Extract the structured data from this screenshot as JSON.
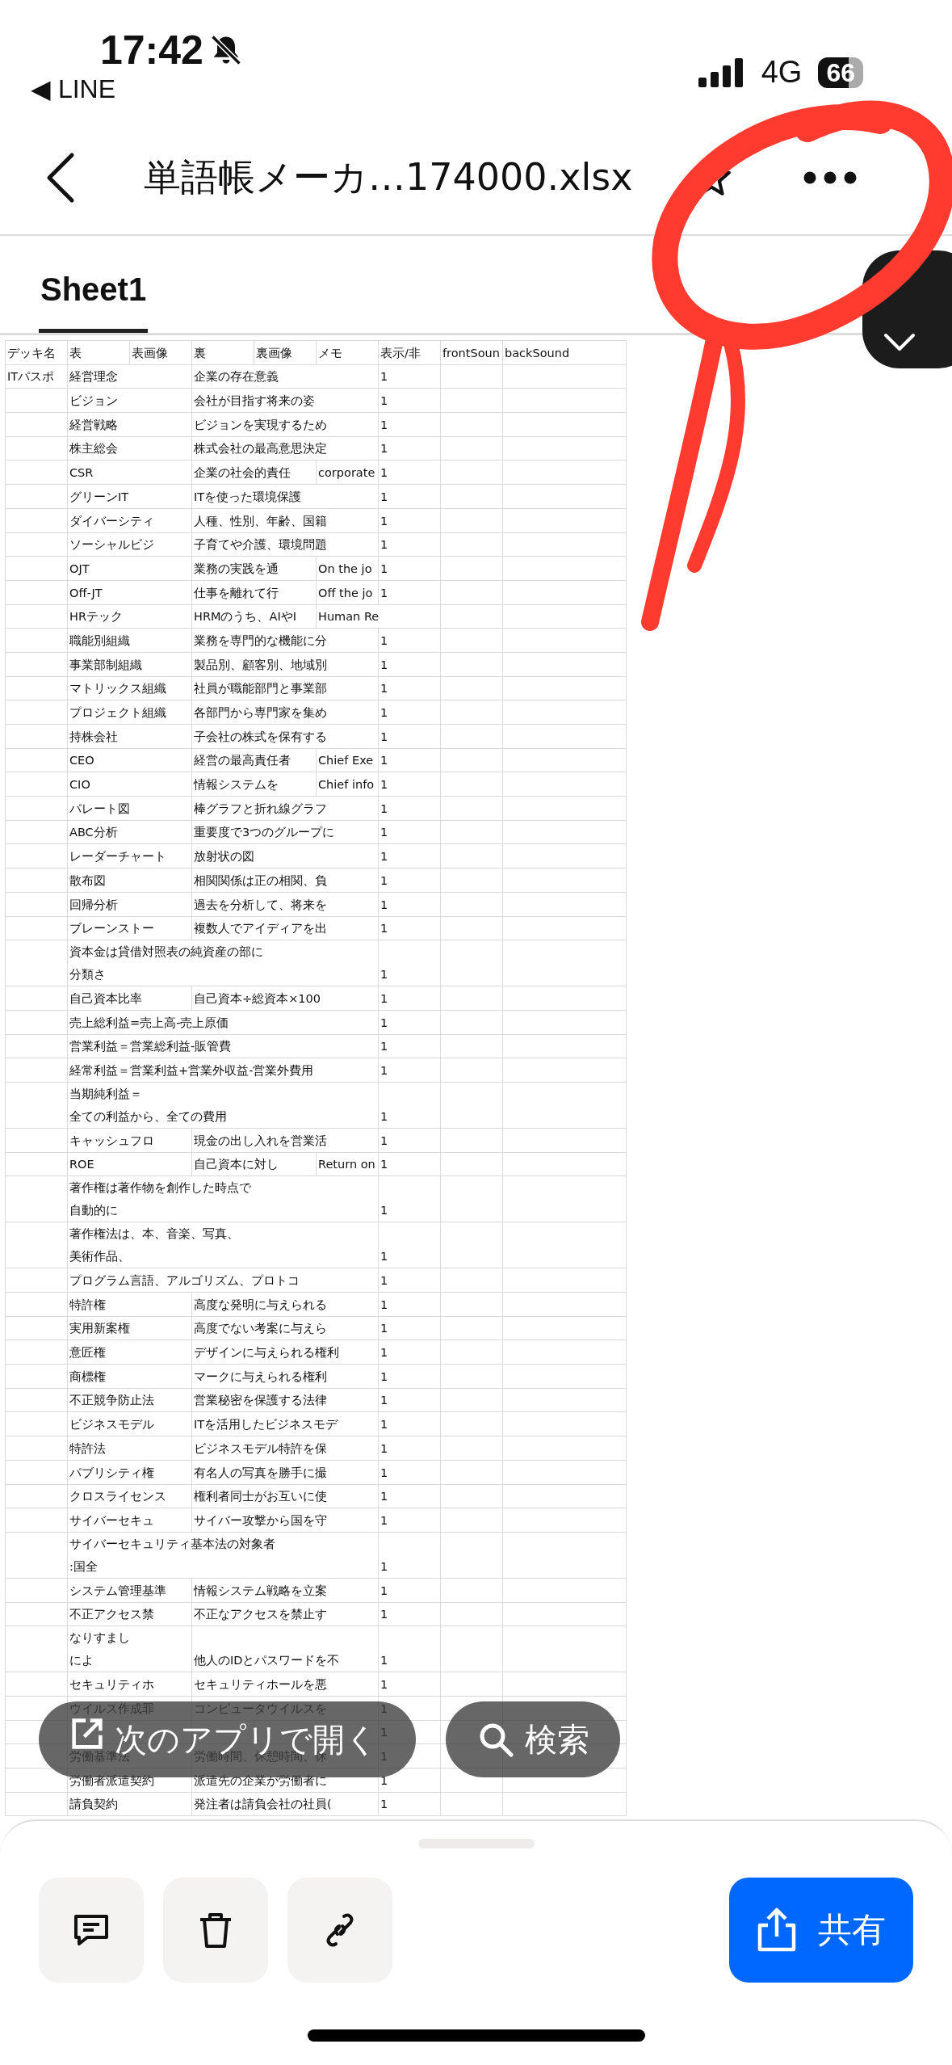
{
  "status_bar": {
    "time": "17:42",
    "back_app": "◀ LINE",
    "network": "4G",
    "battery": "66"
  },
  "header": {
    "title": "単語帳メーカ…174000.xlsx"
  },
  "tabs": [
    {
      "label": "Sheet1",
      "selected": true
    }
  ],
  "table": {
    "columns": [
      "デッキ名",
      "表",
      "表画像",
      "裏",
      "裏画像",
      "メモ",
      "表示/非",
      "frontSoun",
      "backSound"
    ],
    "rows": [
      {
        "deck": "ITパスポ",
        "front": "経営理念",
        "back": "企業の存在意義",
        "show": "1"
      },
      {
        "front": "ビジョン",
        "back": "会社が目指す将来の姿",
        "show": "1"
      },
      {
        "front": "経営戦略",
        "back": "ビジョンを実現するため",
        "show": "1"
      },
      {
        "front": "株主総会",
        "back": "株式会社の最高意思決定",
        "show": "1"
      },
      {
        "front": "CSR",
        "back": "企業の社会的責任",
        "memo": "corporate",
        "show": "1"
      },
      {
        "front": "グリーンIT",
        "back": "ITを使った環境保護",
        "show": "1"
      },
      {
        "front": "ダイバーシティ",
        "back": "人種、性別、年齢、国籍",
        "show": "1"
      },
      {
        "front": "ソーシャルビジ",
        "back": "子育てや介護、環境問題",
        "show": "1"
      },
      {
        "front": "OJT",
        "back": "業務の実践を通",
        "memo": "On the jo",
        "show": "1"
      },
      {
        "front": "Off-JT",
        "back": "仕事を離れて行",
        "memo": "Off the jo",
        "show": "1"
      },
      {
        "front": "HRテック",
        "back": "HRMのうち、AIやI",
        "memo": "Human Re"
      },
      {
        "front": "職能別組織",
        "back": "業務を専門的な機能に分",
        "show": "1"
      },
      {
        "front": "事業部制組織",
        "back": "製品別、顧客別、地域別",
        "show": "1"
      },
      {
        "front": "マトリックス組織",
        "back": "社員が職能部門と事業部",
        "show": "1"
      },
      {
        "front": "プロジェクト組織",
        "back": "各部門から専門家を集め",
        "show": "1"
      },
      {
        "front": "持株会社",
        "back": "子会社の株式を保有する",
        "show": "1"
      },
      {
        "front": "CEO",
        "back": "経営の最高責任者",
        "memo": "Chief Exe",
        "show": "1"
      },
      {
        "front": "CIO",
        "back": "情報システムを",
        "memo": "Chief info",
        "show": "1"
      },
      {
        "front": "パレート図",
        "back": "棒グラフと折れ線グラフ",
        "show": "1"
      },
      {
        "front": "ABC分析",
        "back": "重要度で3つのグループに",
        "show": "1"
      },
      {
        "front": "レーダーチャート",
        "back": "放射状の図",
        "show": "1"
      },
      {
        "front": "散布図",
        "back": "相関関係は正の相関、負",
        "show": "1"
      },
      {
        "front": "回帰分析",
        "back": "過去を分析して、将来を",
        "show": "1"
      },
      {
        "front": "ブレーンストー",
        "back": "複数人でアイディアを出",
        "show": "1"
      },
      {
        "front": [
          "資本金は貸借対照表の純資産の部に",
          "分類さ"
        ],
        "show": "1"
      },
      {
        "front": "自己資本比率",
        "back": "自己資本÷総資本×100",
        "show": "1"
      },
      {
        "front": "売上総利益=売上高-売上原価",
        "show": "1"
      },
      {
        "front": "営業利益＝営業総利益-販管費",
        "show": "1"
      },
      {
        "front": "経常利益＝営業利益+営業外収益-営業外費用",
        "show": "1"
      },
      {
        "front": [
          "当期純利益＝",
          "全ての利益から、全ての費用"
        ],
        "show": "1"
      },
      {
        "front": "キャッシュフロ",
        "back": "現金の出し入れを営業活",
        "show": "1"
      },
      {
        "front": "ROE",
        "back": "自己資本に対し",
        "memo": "Return on",
        "show": "1"
      },
      {
        "front": [
          "著作権は著作物を創作した時点で",
          "自動的に"
        ],
        "show": "1"
      },
      {
        "front": [
          "著作権法は、本、音楽、写真、",
          "美術作品、"
        ],
        "show": "1"
      },
      {
        "front": "プログラム言語、アルゴリズム、プロトコ",
        "show": "1"
      },
      {
        "front": "特許権",
        "back": "高度な発明に与えられる",
        "show": "1"
      },
      {
        "front": "実用新案権",
        "back": "高度でない考案に与えら",
        "show": "1"
      },
      {
        "front": "意匠権",
        "back": "デザインに与えられる権利",
        "show": "1"
      },
      {
        "front": "商標権",
        "back": "マークに与えられる権利",
        "show": "1"
      },
      {
        "front": "不正競争防止法",
        "back": "営業秘密を保護する法律",
        "show": "1"
      },
      {
        "front": "ビジネスモデル",
        "back": "ITを活用したビジネスモデ",
        "show": "1"
      },
      {
        "front": "特許法",
        "back": "ビジネスモデル特許を保",
        "show": "1"
      },
      {
        "front": "パブリシティ権",
        "back": "有名人の写真を勝手に撮",
        "show": "1"
      },
      {
        "front": "クロスライセンス",
        "back": "権利者同士がお互いに使",
        "show": "1"
      },
      {
        "front": "サイバーセキュ",
        "back": "サイバー攻撃から国を守",
        "show": "1"
      },
      {
        "front": [
          "サイバーセキュリティ基本法の対象者",
          ":国全"
        ],
        "show": "1"
      },
      {
        "front": "システム管理基準",
        "back": "情報システム戦略を立案",
        "show": "1"
      },
      {
        "front": "不正アクセス禁",
        "back": "不正なアクセスを禁止す",
        "show": "1"
      },
      {
        "front": [
          "なりすまし",
          "によ"
        ],
        "back": "他人のIDとパスワードを不",
        "show": "1"
      },
      {
        "front": "セキュリティホ",
        "back": "セキュリティホールを悪",
        "show": "1"
      },
      {
        "front": "ウイルス作成罪",
        "back": "コンピュータウイルスを",
        "show": "1"
      },
      {
        "show": "1"
      },
      {
        "front": "労働基準法",
        "back": "労働時間、休憩時間、休",
        "show": "1"
      },
      {
        "front": "労働者派遣契約",
        "back": "派遣先の企業が労働者に",
        "show": "1"
      },
      {
        "front": "請負契約",
        "back": "発注者は請負会社の社員(",
        "show": "1"
      }
    ]
  },
  "floating_actions": [
    {
      "kind": "open",
      "label": "次のアプリで開く"
    },
    {
      "kind": "search",
      "label": "検索"
    }
  ],
  "bottom_bar": {
    "actions": [
      {
        "kind": "comment"
      },
      {
        "kind": "delete"
      },
      {
        "kind": "link"
      }
    ],
    "share": {
      "label": "共有"
    }
  }
}
